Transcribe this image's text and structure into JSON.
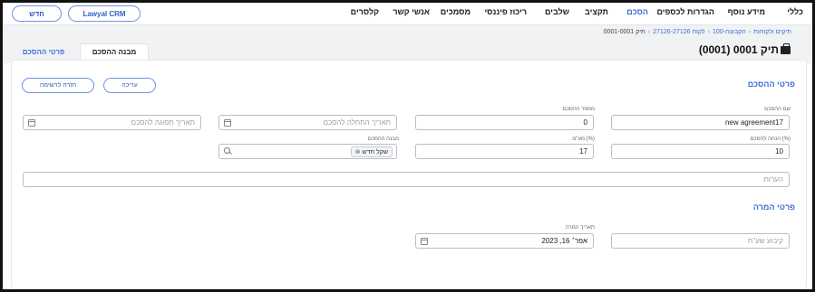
{
  "topnav": {
    "items": [
      {
        "label": "כללי",
        "active": false
      },
      {
        "label": "מידע נוסף",
        "active": false
      },
      {
        "label": "הגדרות לכספים",
        "active": false
      },
      {
        "label": "הסכם",
        "active": true
      },
      {
        "label": "תקציב",
        "active": false
      },
      {
        "label": "שלבים",
        "active": false
      },
      {
        "label": "ריכוז פיננסי",
        "active": false
      },
      {
        "label": "מסמכים",
        "active": false
      },
      {
        "label": "אנשי קשר",
        "active": false
      },
      {
        "label": "קלסרים",
        "active": false
      }
    ],
    "crm_button": "Lawyal CRM",
    "new_button": "חדש"
  },
  "breadcrumb": {
    "items": [
      "תיקים ולקוחות",
      "הקבוצה-100",
      "לקוח 27126-27126",
      "תיק 0001-0001"
    ]
  },
  "page": {
    "title": "תיק 0001 (0001)"
  },
  "tabs": {
    "details": "פרטי ההסכם",
    "structure": "מבנה ההסכם"
  },
  "agreement": {
    "section_title": "פרטי ההסכם",
    "edit_button": "עריכה",
    "back_button": "חזרה לרשימה",
    "name": {
      "label": "שם ההסכם",
      "value": "new agreement17"
    },
    "number": {
      "label": "מספר ההסכם",
      "value": "0"
    },
    "start_date": {
      "placeholder": "תאריך התחלה להסכם"
    },
    "end_date": {
      "placeholder": "תאריך תפוגה להסכם"
    },
    "discount": {
      "label": "הנחה להסכם (%)",
      "value": "10"
    },
    "vat": {
      "label": "מע\"מ (%)",
      "value": "17"
    },
    "structure": {
      "label": "מבנה ההסכם",
      "chip": "שקל חדש"
    },
    "notes": {
      "placeholder": "הערות"
    }
  },
  "conversion": {
    "section_title": "פרטי המרה",
    "rate": {
      "placeholder": "קיבוע שע\"ח"
    },
    "date": {
      "label": "תאריך המרה",
      "value": "אפר׳ 16, 2023"
    }
  }
}
